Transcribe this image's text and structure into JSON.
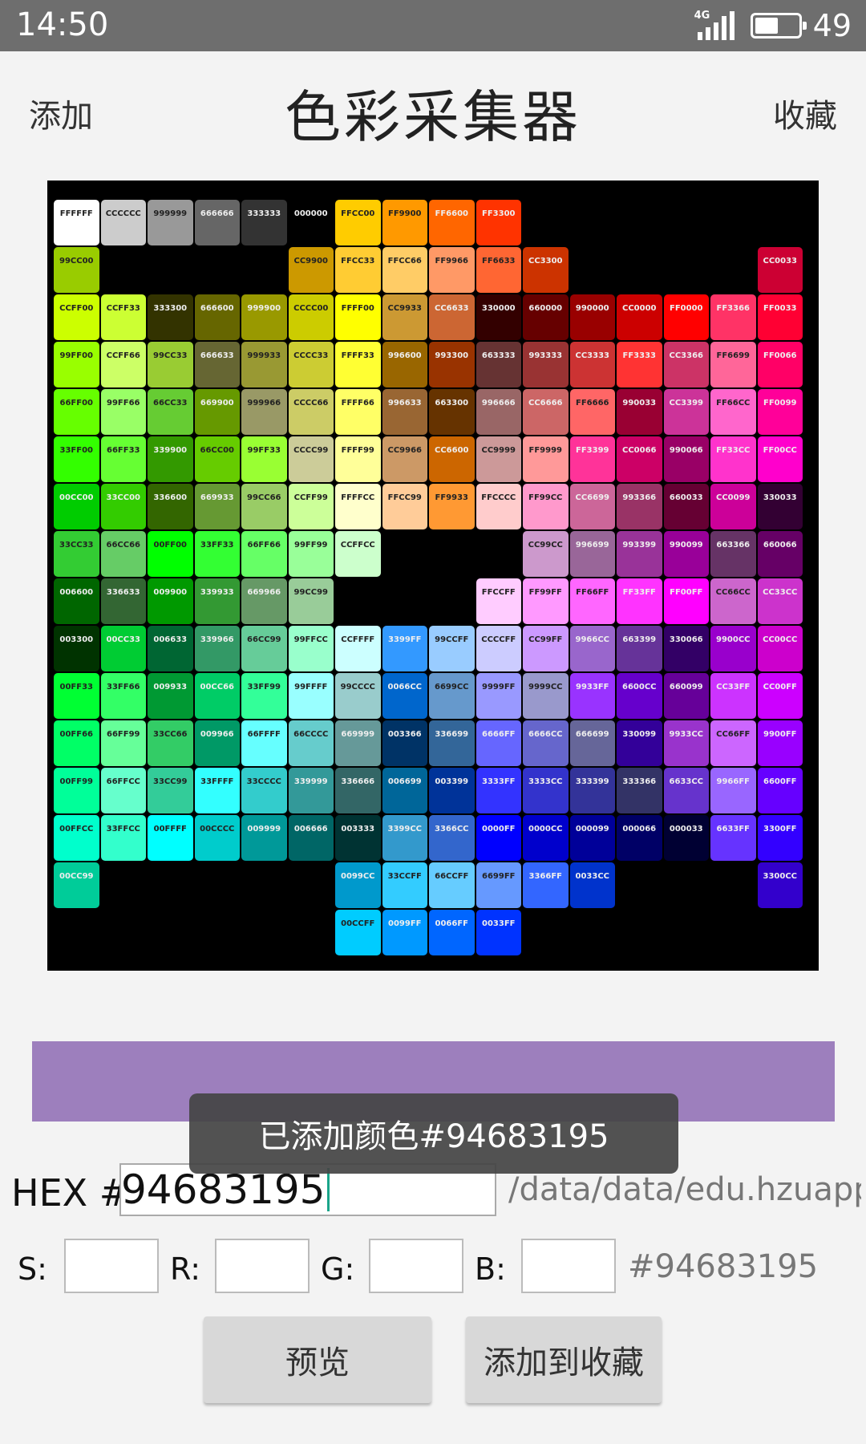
{
  "status_bar": {
    "time": "14:50",
    "network": "4G",
    "battery": "49"
  },
  "header": {
    "left_action": "添加",
    "title": "色彩采集器",
    "right_action": "收藏"
  },
  "palette_image": {
    "swatches": [
      {
        "code": "FFFFFF",
        "color": "#FFFFFF"
      },
      {
        "code": "CCCCCC",
        "color": "#CCCCCC"
      },
      {
        "code": "999999",
        "color": "#999999"
      },
      {
        "code": "666666",
        "color": "#666666"
      },
      {
        "code": "333333",
        "color": "#333333"
      },
      {
        "code": "000000",
        "color": "#000000"
      },
      {
        "code": "FFCC00",
        "color": "#FFCC00"
      },
      {
        "code": "FF9900",
        "color": "#FF9900"
      },
      {
        "code": "FF6600",
        "color": "#FF6600"
      },
      {
        "code": "FF3300",
        "color": "#FF3300"
      },
      {
        "code": "99CC00",
        "color": "#99CC00"
      },
      {
        "code": "CC9900",
        "color": "#CC9900"
      },
      {
        "code": "FFCC33",
        "color": "#FFCC33"
      },
      {
        "code": "FFCC66",
        "color": "#FFCC66"
      },
      {
        "code": "FF9966",
        "color": "#FF9966"
      },
      {
        "code": "FF6633",
        "color": "#FF6633"
      },
      {
        "code": "CC3300",
        "color": "#CC3300"
      },
      {
        "code": "CC0033",
        "color": "#CC0033"
      },
      {
        "code": "CCFF00",
        "color": "#CCFF00"
      },
      {
        "code": "CCFF33",
        "color": "#CCFF33"
      },
      {
        "code": "333300",
        "color": "#333300"
      },
      {
        "code": "666600",
        "color": "#666600"
      },
      {
        "code": "999900",
        "color": "#999900"
      },
      {
        "code": "CCCC00",
        "color": "#CCCC00"
      },
      {
        "code": "FFFF00",
        "color": "#FFFF00"
      },
      {
        "code": "CC9933",
        "color": "#CC9933"
      },
      {
        "code": "CC6633",
        "color": "#CC6633"
      },
      {
        "code": "330000",
        "color": "#330000"
      },
      {
        "code": "660000",
        "color": "#660000"
      },
      {
        "code": "990000",
        "color": "#990000"
      },
      {
        "code": "CC0000",
        "color": "#CC0000"
      },
      {
        "code": "FF0000",
        "color": "#FF0000"
      },
      {
        "code": "FF3366",
        "color": "#FF3366"
      },
      {
        "code": "FF0033",
        "color": "#FF0033"
      },
      {
        "code": "99FF00",
        "color": "#99FF00"
      },
      {
        "code": "CCFF66",
        "color": "#CCFF66"
      },
      {
        "code": "99CC33",
        "color": "#99CC33"
      },
      {
        "code": "666633",
        "color": "#666633"
      },
      {
        "code": "999933",
        "color": "#999933"
      },
      {
        "code": "CCCC33",
        "color": "#CCCC33"
      },
      {
        "code": "FFFF33",
        "color": "#FFFF33"
      },
      {
        "code": "996600",
        "color": "#996600"
      },
      {
        "code": "993300",
        "color": "#993300"
      },
      {
        "code": "663333",
        "color": "#663333"
      },
      {
        "code": "993333",
        "color": "#993333"
      },
      {
        "code": "CC3333",
        "color": "#CC3333"
      },
      {
        "code": "FF3333",
        "color": "#FF3333"
      },
      {
        "code": "CC3366",
        "color": "#CC3366"
      },
      {
        "code": "FF6699",
        "color": "#FF6699"
      },
      {
        "code": "FF0066",
        "color": "#FF0066"
      },
      {
        "code": "66FF00",
        "color": "#66FF00"
      },
      {
        "code": "99FF66",
        "color": "#99FF66"
      },
      {
        "code": "66CC33",
        "color": "#66CC33"
      },
      {
        "code": "669900",
        "color": "#669900"
      },
      {
        "code": "999966",
        "color": "#999966"
      },
      {
        "code": "CCCC66",
        "color": "#CCCC66"
      },
      {
        "code": "FFFF66",
        "color": "#FFFF66"
      },
      {
        "code": "996633",
        "color": "#996633"
      },
      {
        "code": "663300",
        "color": "#663300"
      },
      {
        "code": "996666",
        "color": "#996666"
      },
      {
        "code": "CC6666",
        "color": "#CC6666"
      },
      {
        "code": "FF6666",
        "color": "#FF6666"
      },
      {
        "code": "990033",
        "color": "#990033"
      },
      {
        "code": "CC3399",
        "color": "#CC3399"
      },
      {
        "code": "FF66CC",
        "color": "#FF66CC"
      },
      {
        "code": "FF0099",
        "color": "#FF0099"
      },
      {
        "code": "33FF00",
        "color": "#33FF00"
      },
      {
        "code": "66FF33",
        "color": "#66FF33"
      },
      {
        "code": "339900",
        "color": "#339900"
      },
      {
        "code": "66CC00",
        "color": "#66CC00"
      },
      {
        "code": "99FF33",
        "color": "#99FF33"
      },
      {
        "code": "CCCC99",
        "color": "#CCCC99"
      },
      {
        "code": "FFFF99",
        "color": "#FFFF99"
      },
      {
        "code": "CC9966",
        "color": "#CC9966"
      },
      {
        "code": "CC6600",
        "color": "#CC6600"
      },
      {
        "code": "CC9999",
        "color": "#CC9999"
      },
      {
        "code": "FF9999",
        "color": "#FF9999"
      },
      {
        "code": "FF3399",
        "color": "#FF3399"
      },
      {
        "code": "CC0066",
        "color": "#CC0066"
      },
      {
        "code": "990066",
        "color": "#990066"
      },
      {
        "code": "FF33CC",
        "color": "#FF33CC"
      },
      {
        "code": "FF00CC",
        "color": "#FF00CC"
      },
      {
        "code": "00CC00",
        "color": "#00CC00"
      },
      {
        "code": "33CC00",
        "color": "#33CC00"
      },
      {
        "code": "336600",
        "color": "#336600"
      },
      {
        "code": "669933",
        "color": "#669933"
      },
      {
        "code": "99CC66",
        "color": "#99CC66"
      },
      {
        "code": "CCFF99",
        "color": "#CCFF99"
      },
      {
        "code": "FFFFCC",
        "color": "#FFFFCC"
      },
      {
        "code": "FFCC99",
        "color": "#FFCC99"
      },
      {
        "code": "FF9933",
        "color": "#FF9933"
      },
      {
        "code": "FFCCCC",
        "color": "#FFCCCC"
      },
      {
        "code": "FF99CC",
        "color": "#FF99CC"
      },
      {
        "code": "CC6699",
        "color": "#CC6699"
      },
      {
        "code": "993366",
        "color": "#993366"
      },
      {
        "code": "660033",
        "color": "#660033"
      },
      {
        "code": "CC0099",
        "color": "#CC0099"
      },
      {
        "code": "330033",
        "color": "#330033"
      },
      {
        "code": "33CC33",
        "color": "#33CC33"
      },
      {
        "code": "66CC66",
        "color": "#66CC66"
      },
      {
        "code": "00FF00",
        "color": "#00FF00"
      },
      {
        "code": "33FF33",
        "color": "#33FF33"
      },
      {
        "code": "66FF66",
        "color": "#66FF66"
      },
      {
        "code": "99FF99",
        "color": "#99FF99"
      },
      {
        "code": "CCFFCC",
        "color": "#CCFFCC"
      },
      {
        "code": "CC99CC",
        "color": "#CC99CC"
      },
      {
        "code": "996699",
        "color": "#996699"
      },
      {
        "code": "993399",
        "color": "#993399"
      },
      {
        "code": "990099",
        "color": "#990099"
      },
      {
        "code": "663366",
        "color": "#663366"
      },
      {
        "code": "660066",
        "color": "#660066"
      },
      {
        "code": "006600",
        "color": "#006600"
      },
      {
        "code": "336633",
        "color": "#336633"
      },
      {
        "code": "009900",
        "color": "#009900"
      },
      {
        "code": "339933",
        "color": "#339933"
      },
      {
        "code": "669966",
        "color": "#669966"
      },
      {
        "code": "99CC99",
        "color": "#99CC99"
      },
      {
        "code": "FFCCFF",
        "color": "#FFCCFF"
      },
      {
        "code": "FF99FF",
        "color": "#FF99FF"
      },
      {
        "code": "FF66FF",
        "color": "#FF66FF"
      },
      {
        "code": "FF33FF",
        "color": "#FF33FF"
      },
      {
        "code": "FF00FF",
        "color": "#FF00FF"
      },
      {
        "code": "CC66CC",
        "color": "#CC66CC"
      },
      {
        "code": "CC33CC",
        "color": "#CC33CC"
      },
      {
        "code": "003300",
        "color": "#003300"
      },
      {
        "code": "00CC33",
        "color": "#00CC33"
      },
      {
        "code": "006633",
        "color": "#006633"
      },
      {
        "code": "339966",
        "color": "#339966"
      },
      {
        "code": "66CC99",
        "color": "#66CC99"
      },
      {
        "code": "99FFCC",
        "color": "#99FFCC"
      },
      {
        "code": "CCFFFF",
        "color": "#CCFFFF"
      },
      {
        "code": "3399FF",
        "color": "#3399FF"
      },
      {
        "code": "99CCFF",
        "color": "#99CCFF"
      },
      {
        "code": "CCCCFF",
        "color": "#CCCCFF"
      },
      {
        "code": "CC99FF",
        "color": "#CC99FF"
      },
      {
        "code": "9966CC",
        "color": "#9966CC"
      },
      {
        "code": "663399",
        "color": "#663399"
      },
      {
        "code": "330066",
        "color": "#330066"
      },
      {
        "code": "9900CC",
        "color": "#9900CC"
      },
      {
        "code": "CC00CC",
        "color": "#CC00CC"
      },
      {
        "code": "00FF33",
        "color": "#00FF33"
      },
      {
        "code": "33FF66",
        "color": "#33FF66"
      },
      {
        "code": "009933",
        "color": "#009933"
      },
      {
        "code": "00CC66",
        "color": "#00CC66"
      },
      {
        "code": "33FF99",
        "color": "#33FF99"
      },
      {
        "code": "99FFFF",
        "color": "#99FFFF"
      },
      {
        "code": "99CCCC",
        "color": "#99CCCC"
      },
      {
        "code": "0066CC",
        "color": "#0066CC"
      },
      {
        "code": "6699CC",
        "color": "#6699CC"
      },
      {
        "code": "9999FF",
        "color": "#9999FF"
      },
      {
        "code": "9999CC",
        "color": "#9999CC"
      },
      {
        "code": "9933FF",
        "color": "#9933FF"
      },
      {
        "code": "6600CC",
        "color": "#6600CC"
      },
      {
        "code": "660099",
        "color": "#660099"
      },
      {
        "code": "CC33FF",
        "color": "#CC33FF"
      },
      {
        "code": "CC00FF",
        "color": "#CC00FF"
      },
      {
        "code": "00FF66",
        "color": "#00FF66"
      },
      {
        "code": "66FF99",
        "color": "#66FF99"
      },
      {
        "code": "33CC66",
        "color": "#33CC66"
      },
      {
        "code": "009966",
        "color": "#009966"
      },
      {
        "code": "66FFFF",
        "color": "#66FFFF"
      },
      {
        "code": "66CCCC",
        "color": "#66CCCC"
      },
      {
        "code": "669999",
        "color": "#669999"
      },
      {
        "code": "003366",
        "color": "#003366"
      },
      {
        "code": "336699",
        "color": "#336699"
      },
      {
        "code": "6666FF",
        "color": "#6666FF"
      },
      {
        "code": "6666CC",
        "color": "#6666CC"
      },
      {
        "code": "666699",
        "color": "#666699"
      },
      {
        "code": "330099",
        "color": "#330099"
      },
      {
        "code": "9933CC",
        "color": "#9933CC"
      },
      {
        "code": "CC66FF",
        "color": "#CC66FF"
      },
      {
        "code": "9900FF",
        "color": "#9900FF"
      },
      {
        "code": "00FF99",
        "color": "#00FF99"
      },
      {
        "code": "66FFCC",
        "color": "#66FFCC"
      },
      {
        "code": "33CC99",
        "color": "#33CC99"
      },
      {
        "code": "33FFFF",
        "color": "#33FFFF"
      },
      {
        "code": "33CCCC",
        "color": "#33CCCC"
      },
      {
        "code": "339999",
        "color": "#339999"
      },
      {
        "code": "336666",
        "color": "#336666"
      },
      {
        "code": "006699",
        "color": "#006699"
      },
      {
        "code": "003399",
        "color": "#003399"
      },
      {
        "code": "3333FF",
        "color": "#3333FF"
      },
      {
        "code": "3333CC",
        "color": "#3333CC"
      },
      {
        "code": "333399",
        "color": "#333399"
      },
      {
        "code": "333366",
        "color": "#333366"
      },
      {
        "code": "6633CC",
        "color": "#6633CC"
      },
      {
        "code": "9966FF",
        "color": "#9966FF"
      },
      {
        "code": "6600FF",
        "color": "#6600FF"
      },
      {
        "code": "00FFCC",
        "color": "#00FFCC"
      },
      {
        "code": "33FFCC",
        "color": "#33FFCC"
      },
      {
        "code": "00FFFF",
        "color": "#00FFFF"
      },
      {
        "code": "00CCCC",
        "color": "#00CCCC"
      },
      {
        "code": "009999",
        "color": "#009999"
      },
      {
        "code": "006666",
        "color": "#006666"
      },
      {
        "code": "003333",
        "color": "#003333"
      },
      {
        "code": "3399CC",
        "color": "#3399CC"
      },
      {
        "code": "3366CC",
        "color": "#3366CC"
      },
      {
        "code": "0000FF",
        "color": "#0000FF"
      },
      {
        "code": "0000CC",
        "color": "#0000CC"
      },
      {
        "code": "000099",
        "color": "#000099"
      },
      {
        "code": "000066",
        "color": "#000066"
      },
      {
        "code": "000033",
        "color": "#000033"
      },
      {
        "code": "6633FF",
        "color": "#6633FF"
      },
      {
        "code": "3300FF",
        "color": "#3300FF"
      },
      {
        "code": "00CC99",
        "color": "#00CC99"
      },
      {
        "code": "0099CC",
        "color": "#0099CC"
      },
      {
        "code": "33CCFF",
        "color": "#33CCFF"
      },
      {
        "code": "66CCFF",
        "color": "#66CCFF"
      },
      {
        "code": "6699FF",
        "color": "#6699FF"
      },
      {
        "code": "3366FF",
        "color": "#3366FF"
      },
      {
        "code": "0033CC",
        "color": "#0033CC"
      },
      {
        "code": "3300CC",
        "color": "#3300CC"
      },
      {
        "code": "00CCFF",
        "color": "#00CCFF"
      },
      {
        "code": "0099FF",
        "color": "#0099FF"
      },
      {
        "code": "0066FF",
        "color": "#0066FF"
      },
      {
        "code": "0033FF",
        "color": "#0033FF"
      }
    ]
  },
  "preview_color": "#9d7fbd",
  "toast": {
    "message": "已添加颜色#94683195"
  },
  "hex": {
    "label": "HEX #",
    "value": "94683195",
    "path": "/data/data/edu.hzuapp.."
  },
  "rgb": {
    "s_label": "S:",
    "r_label": "R:",
    "g_label": "G:",
    "b_label": "B:",
    "hex_readout": "#94683195"
  },
  "buttons": {
    "preview": "预览",
    "add_favorite": "添加到收藏"
  }
}
